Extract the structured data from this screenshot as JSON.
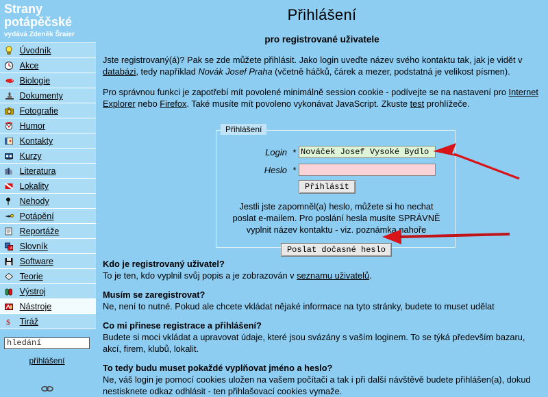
{
  "site": {
    "logo_line1": "Strany",
    "logo_line2": "potápěčské",
    "logo_sub": "vydává Zdeněk Šraier"
  },
  "sidebar": {
    "items": [
      {
        "label": "Úvodník",
        "icon": "lightbulb-icon",
        "active": false
      },
      {
        "label": "Akce",
        "icon": "clock-icon",
        "active": false
      },
      {
        "label": "Biologie",
        "icon": "fish-icon",
        "active": false
      },
      {
        "label": "Dokumenty",
        "icon": "stamp-icon",
        "active": false
      },
      {
        "label": "Fotografie",
        "icon": "camera-icon",
        "active": false
      },
      {
        "label": "Humor",
        "icon": "clown-icon",
        "active": false
      },
      {
        "label": "Kontakty",
        "icon": "rolodex-icon",
        "active": false
      },
      {
        "label": "Kurzy",
        "icon": "projector-icon",
        "active": false
      },
      {
        "label": "Literatura",
        "icon": "books-icon",
        "active": false
      },
      {
        "label": "Lokality",
        "icon": "diveflag-icon",
        "active": false
      },
      {
        "label": "Nehody",
        "icon": "pin-icon",
        "active": false
      },
      {
        "label": "Potápění",
        "icon": "diver-icon",
        "active": false
      },
      {
        "label": "Reportáže",
        "icon": "notepad-icon",
        "active": false
      },
      {
        "label": "Slovník",
        "icon": "translate-icon",
        "active": false
      },
      {
        "label": "Software",
        "icon": "floppy-icon",
        "active": false
      },
      {
        "label": "Teorie",
        "icon": "diamond-icon",
        "active": false
      },
      {
        "label": "Výstroj",
        "icon": "tanks-icon",
        "active": false
      },
      {
        "label": "Nástroje",
        "icon": "tools-icon",
        "active": true
      },
      {
        "label": "Tiráž",
        "icon": "dollar-icon",
        "active": false
      }
    ],
    "search": {
      "value": "hledání",
      "placeholder": "hledání",
      "icon": "search-input"
    },
    "login_link": "přihlášení",
    "chain_icon": "chain-link-icon"
  },
  "main": {
    "title": "Přihlášení",
    "subtitle": "pro registrované uživatele",
    "intro1": {
      "part1": "Jste registrovaný(á)? Pak se zde můžete přihlásit. Jako login uveďte název svého kontaktu tak, jak je vidět v ",
      "link1": "databázi",
      "part2": ", tedy například ",
      "italic1": "Novák Josef Praha",
      "part3": " (včetně háčků, čárek a mezer, podstatná je velikost písmen)."
    },
    "intro2": {
      "part1": "Pro správnou funkci je zapotřebí mít povolené minimálně session cookie - podívejte se na nastavení pro ",
      "link1": "Internet Explorer",
      "part2": " nebo ",
      "link2": "Firefox",
      "part3": ". Také musíte mít povoleno vykonávat JavaScript. Zkuste ",
      "link3": "test",
      "part4": " prohlížeče."
    }
  },
  "form": {
    "legend": "Přihlášení",
    "login_label": "Login",
    "login_required": "*",
    "login_value": "Nováček Josef Vysoké Bydlo",
    "login_placeholder": "",
    "heslo_label": "Heslo",
    "heslo_required": "*",
    "heslo_value": "",
    "heslo_placeholder": "",
    "submit_label": "Přihlásit",
    "forgot_line1": "Jestli jste zapomněl(a) heslo, můžete si ho nechat",
    "forgot_line2": "poslat e-mailem. Pro poslání hesla musíte SPRÁVNĚ",
    "forgot_line3": "vyplnit název kontaktu - viz. poznámka nahoře",
    "send_pass_label": "Poslat dočasné heslo"
  },
  "faq": [
    {
      "question": "Kdo je registrovaný uživatel?",
      "answer_part1": "To je ten, kdo vyplnil svůj popis a je zobrazován v ",
      "answer_link": "seznamu uživatelů",
      "answer_part2": "."
    },
    {
      "question": "Musím se zaregistrovat?",
      "answer_part1": "Ne, není to nutné. Pokud ale chcete vkládat nějaké informace na tyto stránky, budete to muset udělat",
      "answer_link": "",
      "answer_part2": ""
    },
    {
      "question": "Co mi přinese registrace a přihlášení?",
      "answer_part1": "Budete si moci vkládat a upravovat údaje, které jsou svázány s vaším loginem. To se týká především bazaru, akcí, firem, klubů, lokalit.",
      "answer_link": "",
      "answer_part2": ""
    },
    {
      "question": "To tedy budu muset pokaždé vyplňovat jméno a heslo?",
      "answer_part1": "Ne, váš login je pomocí cookies uložen na vašem počítači a tak i při další návštěvě budete přihlášen(a), dokud nestisknete odkaz odhlásit - ten přihlašovací cookies vymaže.",
      "answer_link": "",
      "answer_part2": ""
    }
  ],
  "annotations": {
    "arrow_color": "#d81418",
    "arrow_login_target": "login-input",
    "arrow_password_target": "send-temp-password-button"
  },
  "colors": {
    "page_background": "#8ecdf2",
    "menu_item_background": "#aadcf6",
    "menu_item_active_background": "#f2fbfe",
    "login_field_background": "#ddf5d6",
    "password_field_background": "#fad3d8",
    "logo_text": "#ffffff"
  }
}
